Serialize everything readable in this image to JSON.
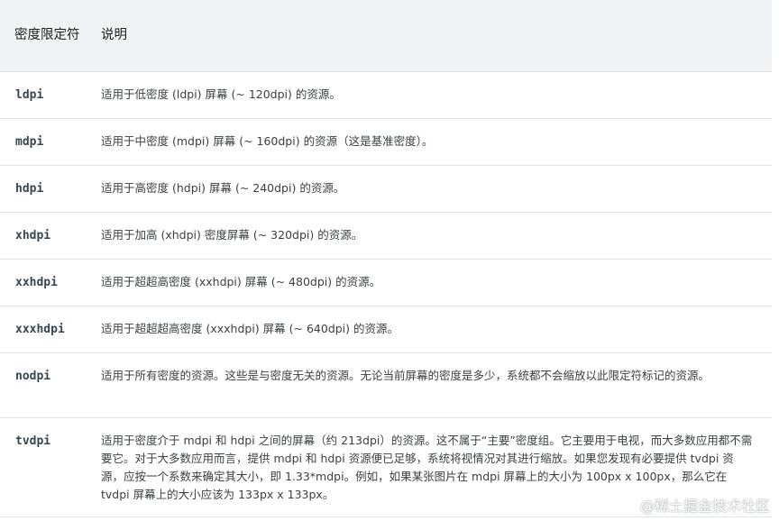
{
  "table": {
    "headers": {
      "qualifier": "密度限定符",
      "description": "说明"
    },
    "rows": [
      {
        "qualifier": "ldpi",
        "description": "适用于低密度 (ldpi) 屏幕 (~ 120dpi) 的资源。"
      },
      {
        "qualifier": "mdpi",
        "description": "适用于中密度 (mdpi) 屏幕 (~ 160dpi) 的资源（这是基准密度）。"
      },
      {
        "qualifier": "hdpi",
        "description": "适用于高密度 (hdpi) 屏幕 (~ 240dpi) 的资源。"
      },
      {
        "qualifier": "xhdpi",
        "description": "适用于加高 (xhdpi) 密度屏幕 (~ 320dpi) 的资源。"
      },
      {
        "qualifier": "xxhdpi",
        "description": "适用于超超高密度 (xxhdpi) 屏幕 (~ 480dpi) 的资源。"
      },
      {
        "qualifier": "xxxhdpi",
        "description": "适用于超超超高密度 (xxxhdpi) 屏幕 (~ 640dpi) 的资源。"
      },
      {
        "qualifier": "nodpi",
        "description": "适用于所有密度的资源。这些是与密度无关的资源。无论当前屏幕的密度是多少，系统都不会缩放以此限定符标记的资源。"
      },
      {
        "qualifier": "tvdpi",
        "description": "适用于密度介于 mdpi 和 hdpi 之间的屏幕（约 213dpi）的资源。这不属于“主要”密度组。它主要用于电视，而大多数应用都不需要它。对于大多数应用而言，提供 mdpi 和 hdpi 资源便已足够，系统将视情况对其进行缩放。如果您发现有必要提供 tvdpi 资源，应按一个系数来确定其大小，即 1.33*mdpi。例如，如果某张图片在 mdpi 屏幕上的大小为 100px x 100px，那么它在 tvdpi 屏幕上的大小应该为 133px x 133px。"
      }
    ]
  },
  "watermark": "@稀土掘金技术社区"
}
